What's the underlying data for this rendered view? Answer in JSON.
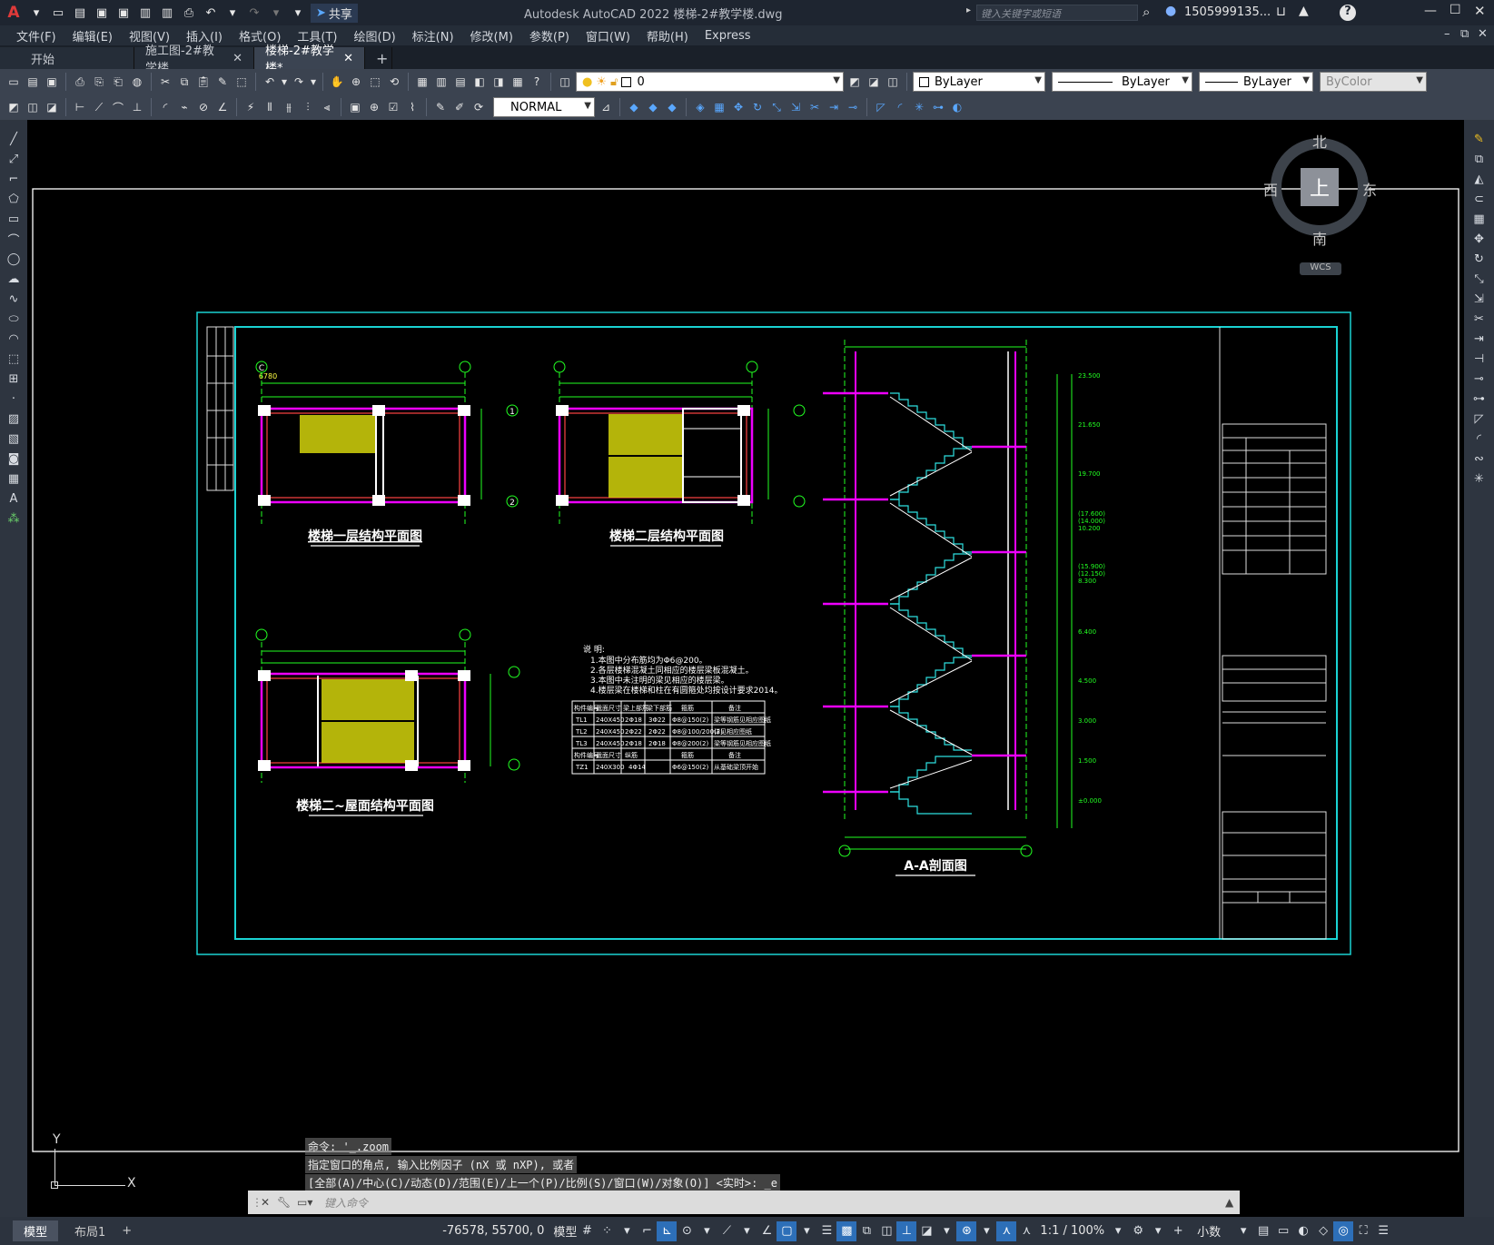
{
  "app": {
    "title": "Autodesk AutoCAD 2022    楼梯-2#教学楼.dwg",
    "share": "共享",
    "search_placeholder": "键入关键字或短语",
    "user": "1505999135...",
    "logo": "A"
  },
  "menu": [
    "文件(F)",
    "编辑(E)",
    "视图(V)",
    "插入(I)",
    "格式(O)",
    "工具(T)",
    "绘图(D)",
    "标注(N)",
    "修改(M)",
    "参数(P)",
    "窗口(W)",
    "帮助(H)",
    "Express"
  ],
  "tabs": [
    {
      "label": "开始"
    },
    {
      "label": "施工图-2#教学楼"
    },
    {
      "label": "楼梯-2#教学楼*"
    }
  ],
  "layer": {
    "name": "0"
  },
  "text_style": "NORMAL",
  "properties": {
    "color": "ByLayer",
    "linetype": "ByLayer",
    "lineweight": "ByLayer",
    "plotstyle": "ByColor"
  },
  "viewcube": {
    "north": "北",
    "south": "南",
    "east": "东",
    "west": "西",
    "face": "上",
    "wcs": "WCS"
  },
  "ucs": {
    "y": "Y",
    "x": "X"
  },
  "drawing": {
    "plan1_title": "楼梯一层结构平面图",
    "plan2_title": "楼梯二层结构平面图",
    "plan3_title": "楼梯二~屋面结构平面图",
    "section_title": "A-A剖面图",
    "axis_c": "C",
    "axis_1": "1",
    "axis_2": "2",
    "notes_title": "说 明:",
    "notes": [
      "1.本图中分布筋均为Φ6@200。",
      "2.各层楼梯混凝土同相应的楼层梁板混凝土。",
      "3.本图中未注明的梁见相应的楼层梁。",
      "4.楼层梁在楼梯和柱在有圆箍处均按设计要求2014。"
    ],
    "table_header": [
      "构件编号",
      "截面尺寸",
      "梁上部筋",
      "梁下部筋",
      "箍筋",
      "备注"
    ],
    "table_rows": [
      [
        "TL1",
        "240X450",
        "2Φ18",
        "3Φ22",
        "Φ8@150(2)",
        "梁等钢筋见相应图纸"
      ],
      [
        "TL2",
        "240X450",
        "2Φ22",
        "2Φ22",
        "Φ8@100/200(2)",
        "详见相应图纸"
      ],
      [
        "TL3",
        "240X450",
        "2Φ18",
        "2Φ18",
        "Φ8@200(2)",
        "梁等钢筋见相应图纸"
      ],
      [
        "构件编号",
        "截面尺寸",
        "纵筋",
        "箍筋",
        "备注",
        ""
      ],
      [
        "TZ1",
        "240X300",
        "4Φ14",
        "Φ6@150(2)",
        "从基础梁顶开始",
        ""
      ]
    ],
    "elevations": [
      "23.500",
      "21.650",
      "19.700",
      "(17.600)",
      "(14.000)",
      "10.200",
      "(15.900)",
      "(12.150)",
      "8.300",
      "6.400",
      "4.500",
      "3.000",
      "1.500",
      "±0.000"
    ],
    "dims": [
      "6780",
      "5540",
      "1500",
      "260X11=3060",
      "1520",
      "1860",
      "1680"
    ]
  },
  "command_history": [
    "命令: '_.zoom",
    "指定窗口的角点, 输入比例因子 (nX 或 nXP), 或者",
    "[全部(A)/中心(C)/动态(D)/范围(E)/上一个(P)/比例(S)/窗口(W)/对象(O)] <实时>: _e"
  ],
  "command_placeholder": "键入命令",
  "layout_tabs": [
    "模型",
    "布局1"
  ],
  "status": {
    "coords": "-76578, 55700, 0",
    "model": "模型",
    "scale": "1:1 / 100%",
    "units": "小数"
  }
}
